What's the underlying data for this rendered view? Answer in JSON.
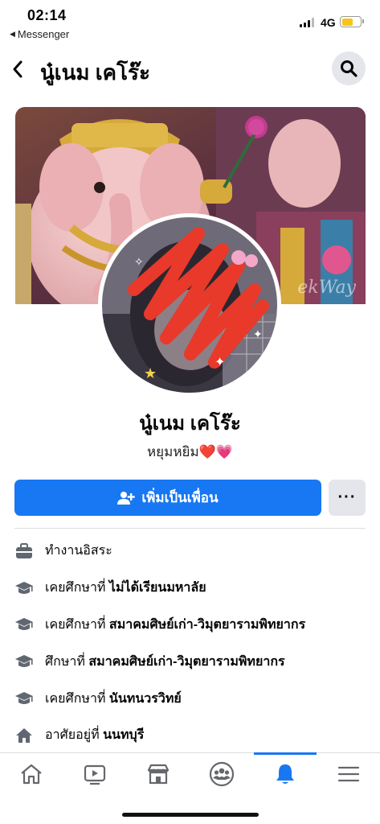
{
  "status_bar": {
    "time": "02:14",
    "back_app": "Messenger",
    "network": "4G",
    "battery_color": "#f5c518"
  },
  "header": {
    "title": "นู๋เนม เคโร๊ะ",
    "back_icon": "chevron-left-icon",
    "search_icon": "search-icon"
  },
  "cover": {
    "watermark": "ekWay"
  },
  "profile": {
    "name": "นู๋เนม เคโร๊ะ",
    "bio": "หยุมหยิม❤️💗"
  },
  "actions": {
    "add_friend_label": "เพิ่มเป็นเพื่อน",
    "more_label": "···",
    "accent": "#1877f2"
  },
  "details": [
    {
      "icon": "briefcase-icon",
      "prefix": "",
      "text": "ทำงานอิสระ"
    },
    {
      "icon": "graduation-cap-icon",
      "prefix": "เคยศึกษาที่ ",
      "text": "ไม่ได้เรียนมหาลัย"
    },
    {
      "icon": "graduation-cap-icon",
      "prefix": "เคยศึกษาที่ ",
      "text": "สมาคมศิษย์เก่า-วิมุตยารามพิทยากร"
    },
    {
      "icon": "graduation-cap-icon",
      "prefix": "ศึกษาที่ ",
      "text": "สมาคมศิษย์เก่า-วิมุตยารามพิทยากร"
    },
    {
      "icon": "graduation-cap-icon",
      "prefix": "เคยศึกษาที่ ",
      "text": "นันทนวรวิทย์"
    },
    {
      "icon": "house-icon",
      "prefix": "อาศัยอยู่ที่ ",
      "text": "นนทบุรี"
    }
  ],
  "bottom_nav": [
    {
      "icon": "home-icon",
      "active": false
    },
    {
      "icon": "video-icon",
      "active": false
    },
    {
      "icon": "marketplace-icon",
      "active": false
    },
    {
      "icon": "groups-icon",
      "active": false
    },
    {
      "icon": "bell-icon",
      "active": true
    },
    {
      "icon": "menu-icon",
      "active": false
    }
  ]
}
